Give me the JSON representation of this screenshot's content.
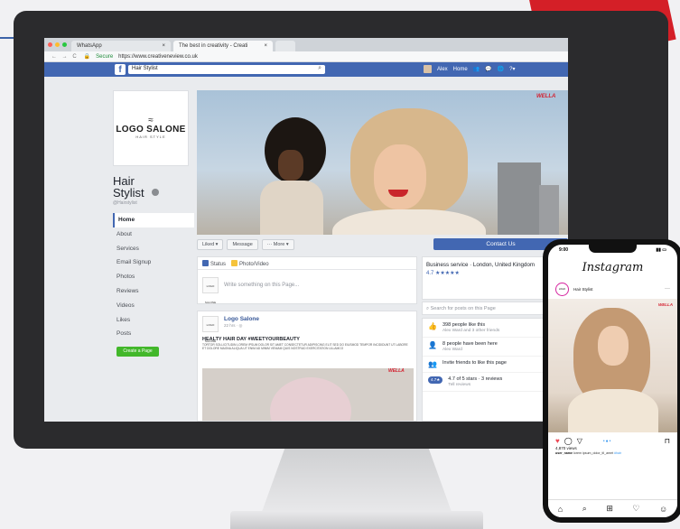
{
  "browser": {
    "tabs": [
      {
        "label": "WhatsApp"
      },
      {
        "label": "The best in creativity - Creati"
      }
    ],
    "address": {
      "secure_label": "Secure",
      "url": "https://www.creativeneview.co.uk"
    }
  },
  "facebook": {
    "search_value": "Hair Stylist",
    "topbar": {
      "user": "Alex",
      "home": "Home"
    },
    "page": {
      "logo_mark": "≈",
      "logo_name": "LOGO SALONE",
      "logo_tagline": "HAIR STYLE",
      "name_line1": "Hair",
      "name_line2": "Stylist",
      "handle": "@Hairstylist"
    },
    "nav": [
      "Home",
      "About",
      "Services",
      "Email Signup",
      "Photos",
      "Reviews",
      "Videos",
      "Likes",
      "Posts"
    ],
    "create_page": "Create a Page",
    "brand": "WELLA",
    "actions": {
      "liked": "Liked ▾",
      "message": "Message",
      "more": "··· More ▾",
      "contact": "Contact Us"
    },
    "composer": {
      "status": "Status",
      "photo": "Photo/Video",
      "placeholder": "Write something on this Page..."
    },
    "post": {
      "author": "Logo Salone",
      "time": "22 hrs · ◎",
      "headline": "HEALTY HAIR DAY #WEETYOURBEAUTY",
      "body": "TORTOR SOLLICITUDIN LOREM IPSUM DOLOR SIT AMET CONSECTETUR ADIPISCING ELIT SED DO EIUSMOD TEMPOR INCIDIDUNT UT LABORE ET DOLORE MAGNA ALIQUA UT ENIM AD MINIM VENIAM QUIS NOSTRUD EXERCITATION ULLAMCO"
    },
    "sidebar": {
      "business": "Business service · London, United Kingdom",
      "rating_stars": "4.7 ★★★★★",
      "search_posts": "Search for posts on this Page",
      "stats": [
        {
          "icon": "👍",
          "line1": "398 people like this",
          "line2": "Alex Ward and 3 other friends"
        },
        {
          "icon": "👤",
          "line1": "8 people have been here",
          "line2": "Alex Ward"
        },
        {
          "icon": "👥",
          "line1": "Invite friends to like this page",
          "line2": ""
        },
        {
          "icon": "4.7★",
          "line1": "4.7 of 5 stars · 3 reviews",
          "line2": "Tell reviews"
        }
      ]
    }
  },
  "instagram": {
    "time": "9:00",
    "logo": "Instagram",
    "user": "Hair Stylist",
    "avatar_label": "LOGO",
    "likes": "4,870 views",
    "caption_user": "user_name",
    "caption_text": "lorem ipsum_dolor_til_amet",
    "tags": "#hair"
  }
}
